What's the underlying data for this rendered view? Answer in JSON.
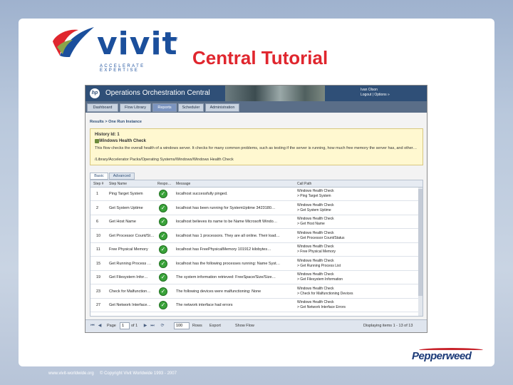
{
  "slide": {
    "title": "Central Tutorial",
    "logo_word": "vivit",
    "logo_tm": "TM",
    "logo_tagline": "ACCELERATE EXPERTISE",
    "footer_url": "www.vivit-worldwide.org",
    "footer_copy": "© Copyright Vivit Worldwide 1993 - 2007",
    "brand_logo": "Pepperweed"
  },
  "app": {
    "title": "Operations Orchestration Central",
    "user_name": "Ivan Olson",
    "user_links": "Logout | Options »",
    "nav_tabs": [
      {
        "label": "Dashboard"
      },
      {
        "label": "Flow Library"
      },
      {
        "label": "Reports",
        "active": true
      },
      {
        "label": "Scheduler"
      },
      {
        "label": "Administration"
      }
    ],
    "breadcrumb": "Results > One Run Instance",
    "info": {
      "history": "History Id: 1",
      "flow_name": "Windows Health Check",
      "description": "This flow checks the overall health of a windows server. It checks for many common problems, such as testing if the server is running, how much free memory the server has, and other…",
      "path": "/Library/Accelerator Packs/Operating Systems/Windows/Windows Health Check"
    },
    "subtabs": [
      {
        "label": "Basic",
        "active": true
      },
      {
        "label": "Advanced"
      }
    ],
    "table": {
      "headers": [
        "Step #",
        "Step Name",
        "Respo…",
        "Message",
        "Call Path"
      ],
      "rows": [
        {
          "step": "1",
          "name": "Ping Target System",
          "message": "localhost successfully pinged.",
          "path1": "Windows Health Check",
          "path2": "> Ping Target System"
        },
        {
          "step": "2",
          "name": "Get System Uptime",
          "message": "localhost has been running for SystemUptime 3423180…",
          "path1": "Windows Health Check",
          "path2": "> Get System Uptime"
        },
        {
          "step": "6",
          "name": "Get Host Name",
          "message": "localhost believes its name to be Name Microsoft Windo…",
          "path1": "Windows Health Check",
          "path2": "> Get Host Name"
        },
        {
          "step": "10",
          "name": "Get Processor Count/St…",
          "message": "localhost has 1 processors. They are all online. Their load…",
          "path1": "Windows Health Check",
          "path2": "> Get Processor Count/Status"
        },
        {
          "step": "11",
          "name": "Free Physical Memory",
          "message": "localhost has FreePhysicalMemory 101912 kilobytes…",
          "path1": "Windows Health Check",
          "path2": "> Free Physical Memory"
        },
        {
          "step": "15",
          "name": "Get Running Process …",
          "message": "localhost has the following processes running: Name Syst…",
          "path1": "Windows Health Check",
          "path2": "> Get Running Process List"
        },
        {
          "step": "19",
          "name": "Get Filesystem Infor…",
          "message": "The system information retrieved: FreeSpace/Size/Size…",
          "path1": "Windows Health Check",
          "path2": "> Get Filesystem Information"
        },
        {
          "step": "23",
          "name": "Check for Malfunction…",
          "message": "The following devices were malfunctioning: None",
          "path1": "Windows Health Check",
          "path2": "> Check for Malfunctioning Devices"
        },
        {
          "step": "27",
          "name": "Get Network Interface…",
          "message": "The network interface had errors",
          "path1": "Windows Health Check",
          "path2": "> Get Network Interface Errors"
        }
      ]
    },
    "pager": {
      "page_label": "Page",
      "page_value": "1",
      "of_label": "of 1",
      "rows_value": "100",
      "rows_label": "Rows",
      "export_label": "Export",
      "show_label": "Show Flow",
      "display_label": "Displaying items 1 - 13 of 13"
    }
  },
  "colors": {
    "accent_red": "#e0262e",
    "brand_blue": "#1b4f9c",
    "header_blue": "#2f4f77",
    "ok_green": "#3aa33a"
  },
  "icons": [
    "hp-logo-icon",
    "flow-icon",
    "check-icon",
    "first-page-icon",
    "prev-page-icon",
    "next-page-icon",
    "last-page-icon",
    "refresh-icon"
  ]
}
